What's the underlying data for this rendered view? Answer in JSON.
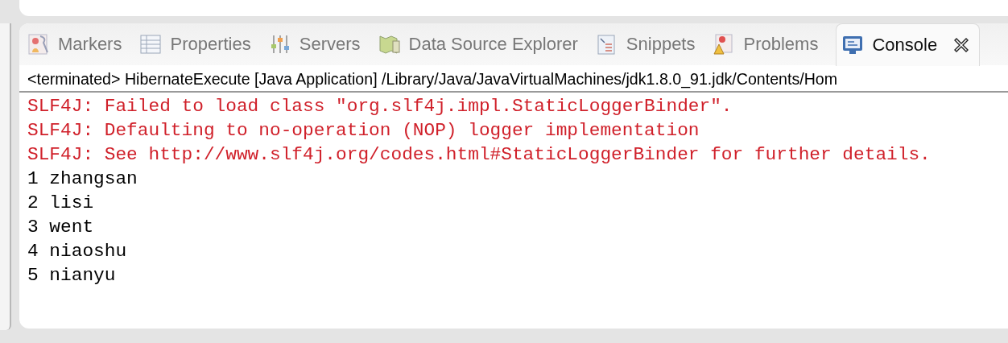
{
  "tabs": [
    {
      "label": "Markers",
      "selected": false
    },
    {
      "label": "Properties",
      "selected": false
    },
    {
      "label": "Servers",
      "selected": false
    },
    {
      "label": "Data Source Explorer",
      "selected": false
    },
    {
      "label": "Snippets",
      "selected": false
    },
    {
      "label": "Problems",
      "selected": false
    },
    {
      "label": "Console",
      "selected": true
    }
  ],
  "console": {
    "header": "<terminated> HibernateExecute [Java Application] /Library/Java/JavaVirtualMachines/jdk1.8.0_91.jdk/Contents/Hom",
    "lines": [
      {
        "kind": "error",
        "text": "SLF4J: Failed to load class \"org.slf4j.impl.StaticLoggerBinder\"."
      },
      {
        "kind": "error",
        "text": "SLF4J: Defaulting to no-operation (NOP) logger implementation"
      },
      {
        "kind": "error",
        "text": "SLF4J: See http://www.slf4j.org/codes.html#StaticLoggerBinder for further details."
      },
      {
        "kind": "output",
        "text": "1 zhangsan"
      },
      {
        "kind": "output",
        "text": "2 lisi"
      },
      {
        "kind": "output",
        "text": "3 went"
      },
      {
        "kind": "output",
        "text": "4 niaoshu"
      },
      {
        "kind": "output",
        "text": "5 nianyu"
      }
    ]
  }
}
